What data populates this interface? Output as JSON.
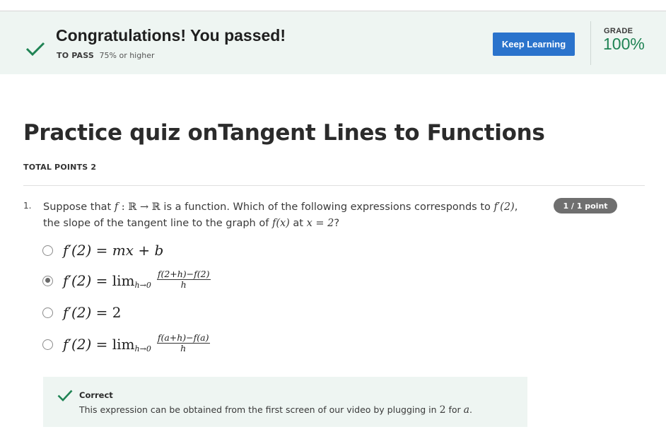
{
  "banner": {
    "title": "Congratulations! You passed!",
    "to_pass_label": "TO PASS",
    "to_pass_value": "75% or higher",
    "keep_learning_label": "Keep Learning",
    "grade_label": "GRADE",
    "grade_value": "100%",
    "icon": "check-icon",
    "accent_color": "#1f8354",
    "button_color": "#2a73cc"
  },
  "quiz": {
    "title": "Practice quiz onTangent Lines to Functions",
    "total_points": "TOTAL POINTS 2"
  },
  "question": {
    "number": "1.",
    "points_badge": "1 / 1 point",
    "text_parts": {
      "p1": "Suppose that ",
      "f": "f",
      "colon": " : ",
      "R1": "ℝ",
      "arrow": " → ",
      "R2": "ℝ",
      "p2": " is a function. Which of the following expressions corresponds to ",
      "fprime2": "f′(2)",
      "p3": ",",
      "p4": "the slope of the tangent line to the graph of ",
      "fx": "f(x)",
      "p5": " at ",
      "xeq": "x = 2",
      "p6": "?"
    },
    "options": [
      {
        "lhs": "f′(2)",
        "rhs": " = mx + b",
        "selected": false
      },
      {
        "lhs": "f′(2)",
        "rhs": " = lim",
        "sub": "h→0",
        "num": "f(2+h)−f(2)",
        "den": "h",
        "selected": true
      },
      {
        "lhs": "f′(2)",
        "rhs": " = 2",
        "selected": false
      },
      {
        "lhs": "f′(2)",
        "rhs": " = lim",
        "sub": "h→0",
        "num": "f(a+h)−f(a)",
        "den": "h",
        "selected": false
      }
    ]
  },
  "feedback": {
    "label": "Correct",
    "text_before": "This expression can be obtained from the first screen of our video by plugging in ",
    "val2": "2",
    "text_mid": " for ",
    "vala": "a",
    "text_end": "."
  }
}
